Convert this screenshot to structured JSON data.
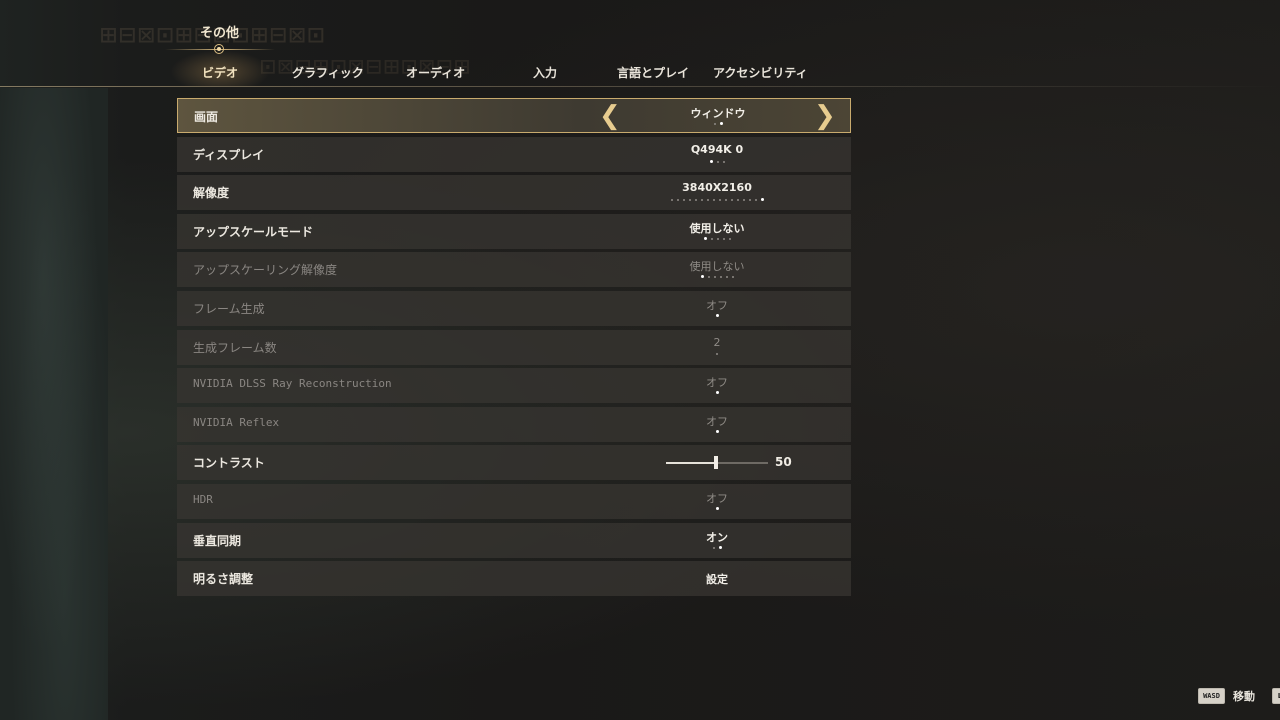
{
  "nav": {
    "category": "その他",
    "tabs": [
      {
        "label": "ビデオ"
      },
      {
        "label": "グラフィック"
      },
      {
        "label": "オーディオ"
      },
      {
        "label": "入力"
      },
      {
        "label": "言語とプレイ"
      },
      {
        "label": "アクセシビリティ"
      }
    ]
  },
  "settings": {
    "screen": {
      "label": "画面",
      "value": "ウィンドウ"
    },
    "display": {
      "label": "ディスプレイ",
      "value": "Q494K 0"
    },
    "resolution": {
      "label": "解像度",
      "value": "3840X2160"
    },
    "upscale_mode": {
      "label": "アップスケールモード",
      "value": "使用しない"
    },
    "upscale_resolution": {
      "label": "アップスケーリング解像度",
      "value": "使用しない"
    },
    "frame_generation": {
      "label": "フレーム生成",
      "value": "オフ"
    },
    "generated_frames": {
      "label": "生成フレーム数",
      "value": "2"
    },
    "dlss_ray_reconstruction": {
      "label": "NVIDIA DLSS Ray Reconstruction",
      "value": "オフ"
    },
    "reflex": {
      "label": "NVIDIA Reflex",
      "value": "オフ"
    },
    "contrast": {
      "label": "コントラスト",
      "value": "50",
      "level_fraction": 0.5
    },
    "hdr": {
      "label": "HDR",
      "value": "オフ"
    },
    "vsync": {
      "label": "垂直同期",
      "value": "オン"
    },
    "brightness": {
      "label": "明るさ調整",
      "value": "設定"
    }
  },
  "hints": {
    "move_key": "WASD",
    "move_label": "移動",
    "next_key": "L"
  },
  "colors": {
    "accent": "#c9ab6e",
    "text": "#ece8e0",
    "disabled_text": "#8a8682"
  }
}
